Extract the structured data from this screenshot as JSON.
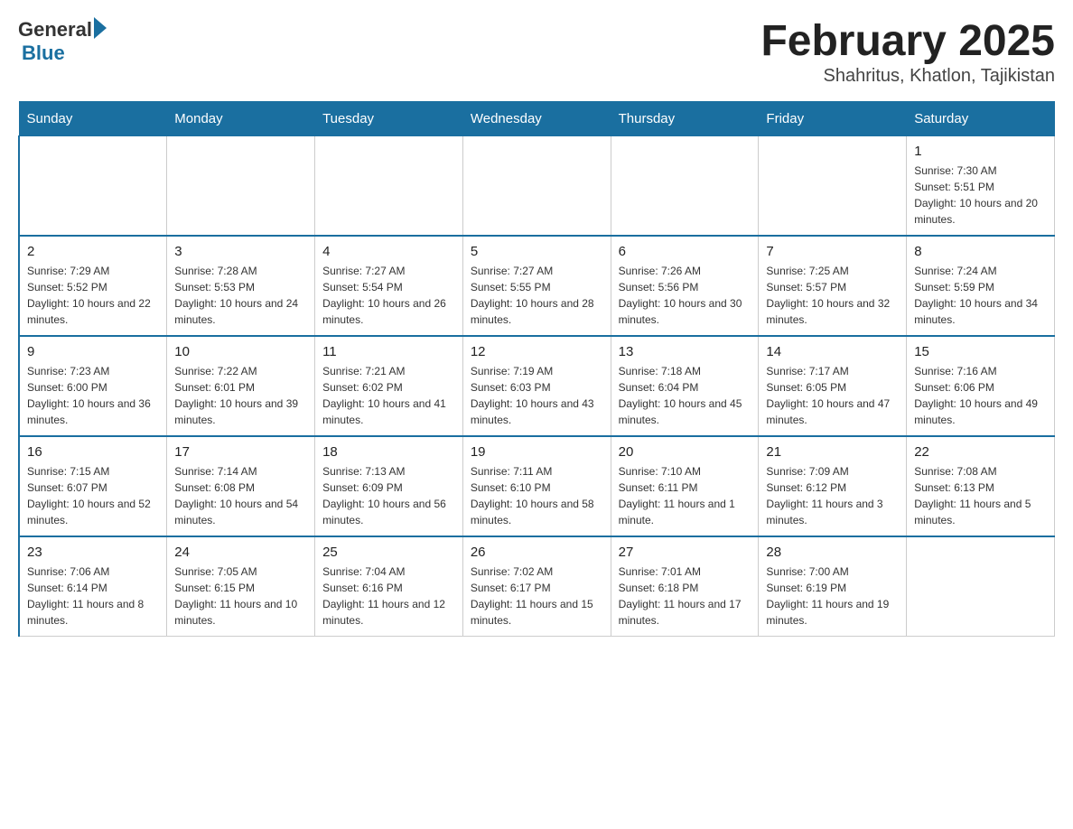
{
  "logo": {
    "text_general": "General",
    "text_blue": "Blue"
  },
  "title": "February 2025",
  "subtitle": "Shahritus, Khatlon, Tajikistan",
  "days_of_week": [
    "Sunday",
    "Monday",
    "Tuesday",
    "Wednesday",
    "Thursday",
    "Friday",
    "Saturday"
  ],
  "weeks": [
    [
      {
        "day": "",
        "sunrise": "",
        "sunset": "",
        "daylight": ""
      },
      {
        "day": "",
        "sunrise": "",
        "sunset": "",
        "daylight": ""
      },
      {
        "day": "",
        "sunrise": "",
        "sunset": "",
        "daylight": ""
      },
      {
        "day": "",
        "sunrise": "",
        "sunset": "",
        "daylight": ""
      },
      {
        "day": "",
        "sunrise": "",
        "sunset": "",
        "daylight": ""
      },
      {
        "day": "",
        "sunrise": "",
        "sunset": "",
        "daylight": ""
      },
      {
        "day": "1",
        "sunrise": "Sunrise: 7:30 AM",
        "sunset": "Sunset: 5:51 PM",
        "daylight": "Daylight: 10 hours and 20 minutes."
      }
    ],
    [
      {
        "day": "2",
        "sunrise": "Sunrise: 7:29 AM",
        "sunset": "Sunset: 5:52 PM",
        "daylight": "Daylight: 10 hours and 22 minutes."
      },
      {
        "day": "3",
        "sunrise": "Sunrise: 7:28 AM",
        "sunset": "Sunset: 5:53 PM",
        "daylight": "Daylight: 10 hours and 24 minutes."
      },
      {
        "day": "4",
        "sunrise": "Sunrise: 7:27 AM",
        "sunset": "Sunset: 5:54 PM",
        "daylight": "Daylight: 10 hours and 26 minutes."
      },
      {
        "day": "5",
        "sunrise": "Sunrise: 7:27 AM",
        "sunset": "Sunset: 5:55 PM",
        "daylight": "Daylight: 10 hours and 28 minutes."
      },
      {
        "day": "6",
        "sunrise": "Sunrise: 7:26 AM",
        "sunset": "Sunset: 5:56 PM",
        "daylight": "Daylight: 10 hours and 30 minutes."
      },
      {
        "day": "7",
        "sunrise": "Sunrise: 7:25 AM",
        "sunset": "Sunset: 5:57 PM",
        "daylight": "Daylight: 10 hours and 32 minutes."
      },
      {
        "day": "8",
        "sunrise": "Sunrise: 7:24 AM",
        "sunset": "Sunset: 5:59 PM",
        "daylight": "Daylight: 10 hours and 34 minutes."
      }
    ],
    [
      {
        "day": "9",
        "sunrise": "Sunrise: 7:23 AM",
        "sunset": "Sunset: 6:00 PM",
        "daylight": "Daylight: 10 hours and 36 minutes."
      },
      {
        "day": "10",
        "sunrise": "Sunrise: 7:22 AM",
        "sunset": "Sunset: 6:01 PM",
        "daylight": "Daylight: 10 hours and 39 minutes."
      },
      {
        "day": "11",
        "sunrise": "Sunrise: 7:21 AM",
        "sunset": "Sunset: 6:02 PM",
        "daylight": "Daylight: 10 hours and 41 minutes."
      },
      {
        "day": "12",
        "sunrise": "Sunrise: 7:19 AM",
        "sunset": "Sunset: 6:03 PM",
        "daylight": "Daylight: 10 hours and 43 minutes."
      },
      {
        "day": "13",
        "sunrise": "Sunrise: 7:18 AM",
        "sunset": "Sunset: 6:04 PM",
        "daylight": "Daylight: 10 hours and 45 minutes."
      },
      {
        "day": "14",
        "sunrise": "Sunrise: 7:17 AM",
        "sunset": "Sunset: 6:05 PM",
        "daylight": "Daylight: 10 hours and 47 minutes."
      },
      {
        "day": "15",
        "sunrise": "Sunrise: 7:16 AM",
        "sunset": "Sunset: 6:06 PM",
        "daylight": "Daylight: 10 hours and 49 minutes."
      }
    ],
    [
      {
        "day": "16",
        "sunrise": "Sunrise: 7:15 AM",
        "sunset": "Sunset: 6:07 PM",
        "daylight": "Daylight: 10 hours and 52 minutes."
      },
      {
        "day": "17",
        "sunrise": "Sunrise: 7:14 AM",
        "sunset": "Sunset: 6:08 PM",
        "daylight": "Daylight: 10 hours and 54 minutes."
      },
      {
        "day": "18",
        "sunrise": "Sunrise: 7:13 AM",
        "sunset": "Sunset: 6:09 PM",
        "daylight": "Daylight: 10 hours and 56 minutes."
      },
      {
        "day": "19",
        "sunrise": "Sunrise: 7:11 AM",
        "sunset": "Sunset: 6:10 PM",
        "daylight": "Daylight: 10 hours and 58 minutes."
      },
      {
        "day": "20",
        "sunrise": "Sunrise: 7:10 AM",
        "sunset": "Sunset: 6:11 PM",
        "daylight": "Daylight: 11 hours and 1 minute."
      },
      {
        "day": "21",
        "sunrise": "Sunrise: 7:09 AM",
        "sunset": "Sunset: 6:12 PM",
        "daylight": "Daylight: 11 hours and 3 minutes."
      },
      {
        "day": "22",
        "sunrise": "Sunrise: 7:08 AM",
        "sunset": "Sunset: 6:13 PM",
        "daylight": "Daylight: 11 hours and 5 minutes."
      }
    ],
    [
      {
        "day": "23",
        "sunrise": "Sunrise: 7:06 AM",
        "sunset": "Sunset: 6:14 PM",
        "daylight": "Daylight: 11 hours and 8 minutes."
      },
      {
        "day": "24",
        "sunrise": "Sunrise: 7:05 AM",
        "sunset": "Sunset: 6:15 PM",
        "daylight": "Daylight: 11 hours and 10 minutes."
      },
      {
        "day": "25",
        "sunrise": "Sunrise: 7:04 AM",
        "sunset": "Sunset: 6:16 PM",
        "daylight": "Daylight: 11 hours and 12 minutes."
      },
      {
        "day": "26",
        "sunrise": "Sunrise: 7:02 AM",
        "sunset": "Sunset: 6:17 PM",
        "daylight": "Daylight: 11 hours and 15 minutes."
      },
      {
        "day": "27",
        "sunrise": "Sunrise: 7:01 AM",
        "sunset": "Sunset: 6:18 PM",
        "daylight": "Daylight: 11 hours and 17 minutes."
      },
      {
        "day": "28",
        "sunrise": "Sunrise: 7:00 AM",
        "sunset": "Sunset: 6:19 PM",
        "daylight": "Daylight: 11 hours and 19 minutes."
      },
      {
        "day": "",
        "sunrise": "",
        "sunset": "",
        "daylight": ""
      }
    ]
  ]
}
